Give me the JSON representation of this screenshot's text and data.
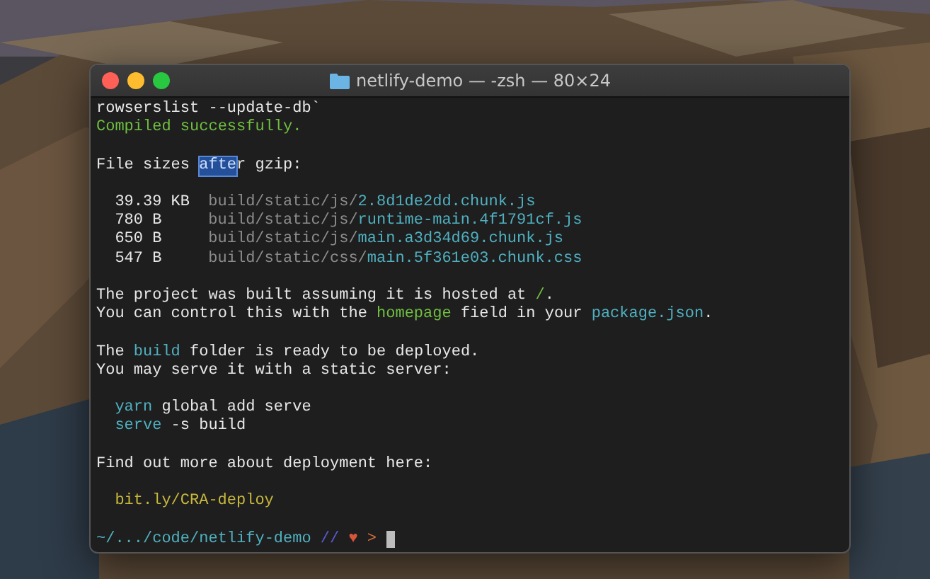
{
  "window": {
    "title": "netlify-demo — -zsh — 80×24"
  },
  "blocks": [
    [
      {
        "indent": false,
        "segments": [
          {
            "text": "rowserslist --update-db`",
            "kind": "plain"
          }
        ]
      },
      {
        "indent": false,
        "segments": [
          {
            "text": "Compiled successfully.",
            "kind": "success"
          }
        ]
      }
    ],
    [
      {
        "indent": false,
        "segments": [
          {
            "text": "File sizes ",
            "kind": "plain"
          },
          {
            "text": "afte",
            "kind": "selected"
          },
          {
            "text": "r gzip:",
            "kind": "plain"
          }
        ]
      }
    ],
    [
      {
        "indent": true,
        "segments": [
          {
            "text": "39.39 KB",
            "kind": "size"
          },
          {
            "text": "build/static/js/",
            "kind": "dim"
          },
          {
            "text": "2.8d1de2dd.chunk.js",
            "kind": "cyan"
          }
        ]
      },
      {
        "indent": true,
        "segments": [
          {
            "text": "780 B",
            "kind": "size"
          },
          {
            "text": "build/static/js/",
            "kind": "dim"
          },
          {
            "text": "runtime-main.4f1791cf.js",
            "kind": "cyan"
          }
        ]
      },
      {
        "indent": true,
        "segments": [
          {
            "text": "650 B",
            "kind": "size"
          },
          {
            "text": "build/static/js/",
            "kind": "dim"
          },
          {
            "text": "main.a3d34d69.chunk.js",
            "kind": "cyan"
          }
        ]
      },
      {
        "indent": true,
        "segments": [
          {
            "text": "547 B",
            "kind": "size"
          },
          {
            "text": "build/static/css/",
            "kind": "dim"
          },
          {
            "text": "main.5f361e03.chunk.css",
            "kind": "cyan"
          }
        ]
      }
    ],
    [
      {
        "indent": false,
        "segments": [
          {
            "text": "The project was built assuming it is hosted at",
            "kind": "plain"
          },
          {
            "text": "/",
            "kind": "success"
          },
          {
            "text": ".",
            "kind": "plain"
          }
        ]
      },
      {
        "indent": false,
        "segments": [
          {
            "text": "You can control this with the",
            "kind": "plain"
          },
          {
            "text": "homepage",
            "kind": "success"
          },
          {
            "text": "field in your",
            "kind": "plain"
          },
          {
            "text": "package.json",
            "kind": "cyan"
          },
          {
            "text": ".",
            "kind": "plain"
          }
        ]
      }
    ],
    [
      {
        "indent": false,
        "segments": [
          {
            "text": "The",
            "kind": "plain"
          },
          {
            "text": "build",
            "kind": "cyan"
          },
          {
            "text": "folder is ready to be deployed.",
            "kind": "plain"
          }
        ]
      },
      {
        "indent": false,
        "segments": [
          {
            "text": "You may serve it with a static server:",
            "kind": "plain"
          }
        ]
      }
    ],
    [
      {
        "indent": true,
        "segments": [
          {
            "text": "yarn",
            "kind": "cyan"
          },
          {
            "text": "global add serve",
            "kind": "plain"
          }
        ]
      },
      {
        "indent": true,
        "segments": [
          {
            "text": "serve",
            "kind": "cyan"
          },
          {
            "text": "-s build",
            "kind": "plain"
          }
        ]
      }
    ],
    [
      {
        "indent": false,
        "segments": [
          {
            "text": "Find out more about deployment here:",
            "kind": "plain"
          }
        ]
      }
    ],
    [
      {
        "indent": true,
        "segments": [
          {
            "text": "bit.ly/CRA-deploy",
            "kind": "link"
          }
        ]
      }
    ]
  ],
  "prompt": {
    "path": "~/.../code/netlify-demo",
    "separator": "//",
    "heart": "♥",
    "arrow": ">"
  }
}
